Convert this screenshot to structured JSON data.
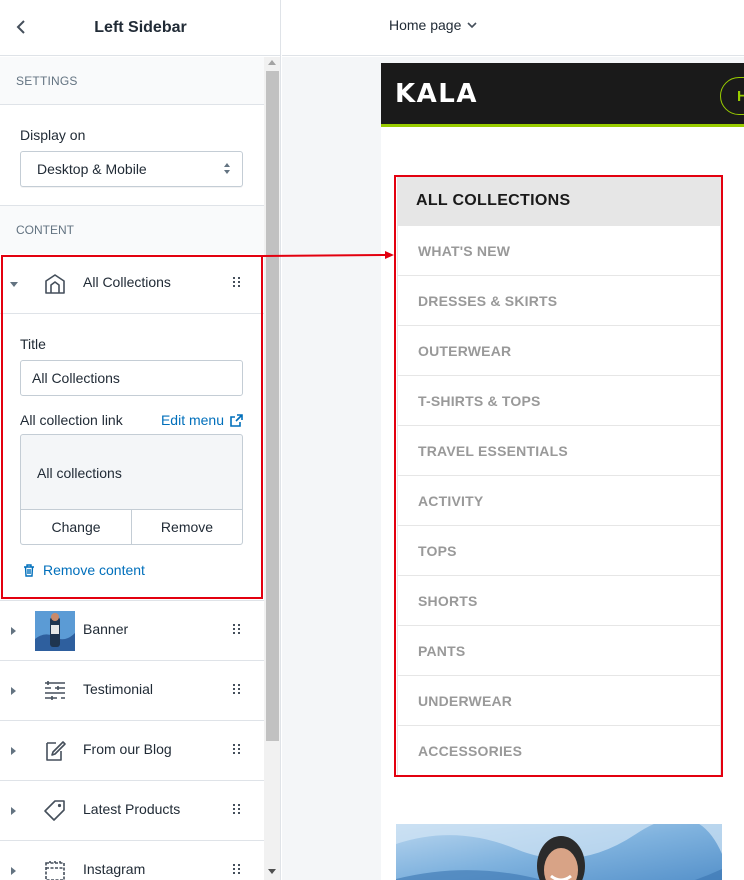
{
  "panel": {
    "title": "Left Sidebar",
    "settings_label": "SETTINGS",
    "display_on_label": "Display on",
    "display_on_value": "Desktop & Mobile",
    "content_label": "CONTENT"
  },
  "expanded_block": {
    "label": "All Collections",
    "title_label": "Title",
    "title_value": "All Collections",
    "link_label": "All collection link",
    "edit_menu": "Edit menu",
    "link_value": "All collections",
    "change": "Change",
    "remove": "Remove",
    "remove_content": "Remove content"
  },
  "blocks": [
    {
      "label": "Banner",
      "icon": "banner-thumbnail"
    },
    {
      "label": "Testimonial",
      "icon": "testimonial-icon"
    },
    {
      "label": "From our Blog",
      "icon": "blog-icon"
    },
    {
      "label": "Latest Products",
      "icon": "tag-icon"
    },
    {
      "label": "Instagram",
      "icon": "instagram-icon"
    }
  ],
  "topbar": {
    "page": "Home page"
  },
  "store": {
    "logo": "KALA",
    "nav_pill": "H",
    "collections_heading": "ALL COLLECTIONS",
    "collections": [
      "WHAT'S NEW",
      "DRESSES & SKIRTS",
      "OUTERWEAR",
      "T-SHIRTS & TOPS",
      "TRAVEL ESSENTIALS",
      "ACTIVITY",
      "TOPS",
      "SHORTS",
      "PANTS",
      "UNDERWEAR",
      "ACCESSORIES"
    ]
  },
  "colors": {
    "highlight": "#e3000f",
    "link": "#006fbb",
    "accent_green": "#99cc00",
    "store_header": "#1a1a1a"
  }
}
